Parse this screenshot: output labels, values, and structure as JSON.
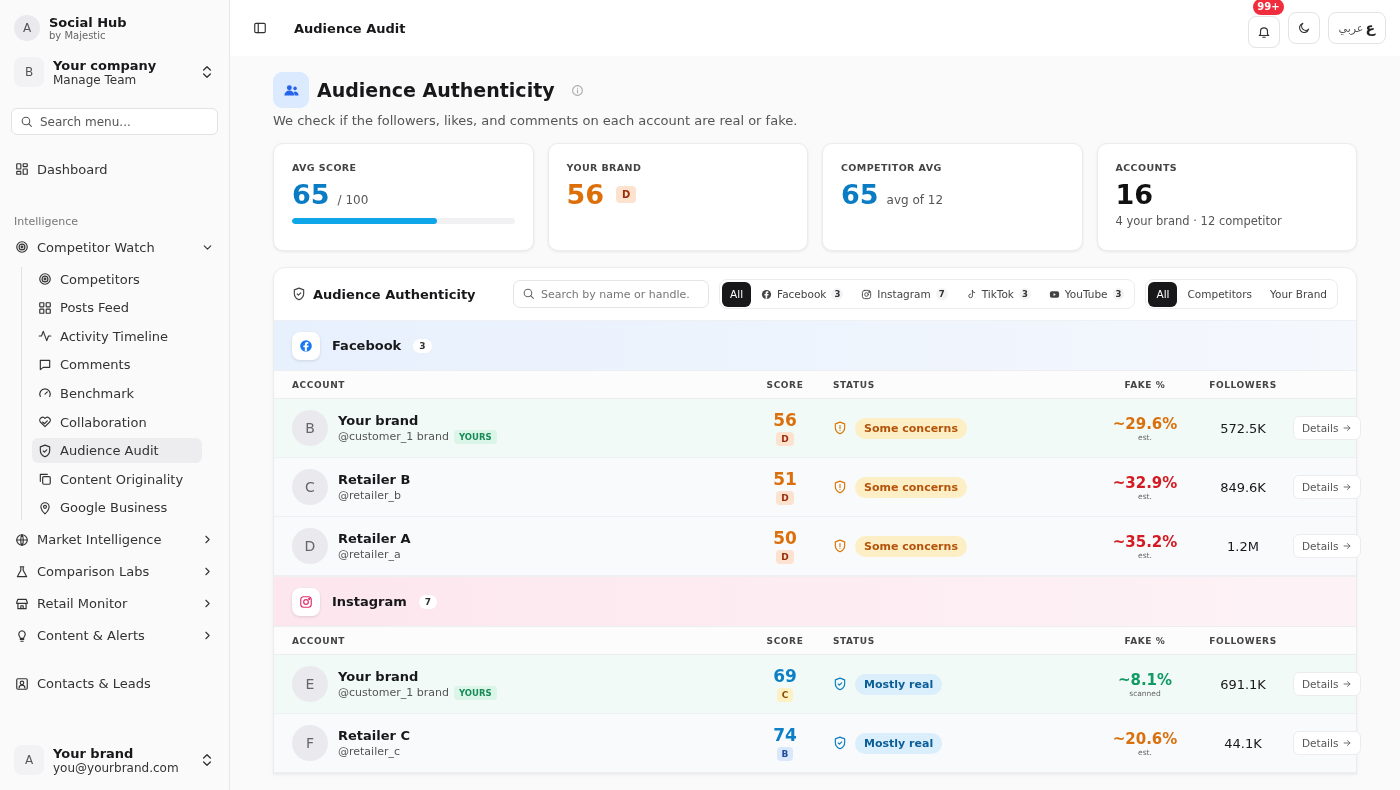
{
  "app": {
    "avatar": "A",
    "name": "Social Hub",
    "by": "by Majestic"
  },
  "team": {
    "avatar": "B",
    "name": "Your company",
    "sub": "Manage Team"
  },
  "sidebar": {
    "search": {
      "placeholder": "Search menu..."
    },
    "items": [
      {
        "kind": "link",
        "label": "Dashboard",
        "selected": false
      },
      {
        "kind": "section",
        "label": "Intelligence"
      },
      {
        "kind": "group",
        "label": "Competitor Watch",
        "expanded": true,
        "children": [
          {
            "label": "Competitors",
            "selected": false
          },
          {
            "label": "Posts Feed",
            "selected": false
          },
          {
            "label": "Activity Timeline",
            "selected": false
          },
          {
            "label": "Comments",
            "selected": false
          },
          {
            "label": "Benchmark",
            "selected": false
          },
          {
            "label": "Collaboration",
            "selected": false
          },
          {
            "label": "Audience Audit",
            "selected": true
          },
          {
            "label": "Content Originality",
            "selected": false
          },
          {
            "label": "Google Business",
            "selected": false
          }
        ]
      },
      {
        "kind": "group",
        "label": "Market Intelligence",
        "expanded": false
      },
      {
        "kind": "group",
        "label": "Comparison Labs",
        "expanded": false
      },
      {
        "kind": "group",
        "label": "Retail Monitor",
        "expanded": false
      },
      {
        "kind": "group",
        "label": "Content & Alerts",
        "expanded": false
      },
      {
        "kind": "link",
        "label": "Contacts & Leads",
        "selected": false
      }
    ]
  },
  "user": {
    "avatar": "A",
    "name": "Your brand",
    "email": "you@yourbrand.com"
  },
  "topbar": {
    "title": "Audience Audit",
    "notifications": "99+",
    "language": "عربي",
    "language_mark": "ع"
  },
  "header": {
    "title": "Audience Authenticity",
    "subtitle": "We check if the followers, likes, and comments on each account are real or fake."
  },
  "stats": [
    {
      "label": "AVG SCORE",
      "value": "65",
      "color": "#0a7cc4",
      "suffix": "/ 100",
      "level": 0.65
    },
    {
      "label": "YOUR BRAND",
      "value": "56",
      "color": "#dd6f0b",
      "grade": "D"
    },
    {
      "label": "COMPETITOR AVG",
      "value": "65",
      "color": "#0a7cc4",
      "suffix": "avg of 12"
    },
    {
      "label": "ACCOUNTS",
      "value": "16",
      "color": "#111111",
      "note": "4 your brand · 12 competitor"
    }
  ],
  "panel": {
    "title": "Audience Authenticity",
    "search": {
      "placeholder": "Search by name or handle."
    },
    "platform_filters": [
      {
        "label": "All",
        "selected": true
      },
      {
        "label": "Facebook",
        "count": "3",
        "selected": false
      },
      {
        "label": "Instagram",
        "count": "7",
        "selected": false
      },
      {
        "label": "TikTok",
        "count": "3",
        "selected": false
      },
      {
        "label": "YouTube",
        "count": "3",
        "selected": false
      }
    ],
    "owner_filters": [
      {
        "label": "All",
        "selected": true
      },
      {
        "label": "Competitors",
        "selected": false
      },
      {
        "label": "Your Brand",
        "selected": false
      }
    ],
    "groups": [
      {
        "kind": "facebook",
        "name": "Facebook",
        "count": "3",
        "columns": [
          "ACCOUNT",
          "SCORE",
          "STATUS",
          "FAKE %",
          "FOLLOWERS"
        ],
        "rows": [
          {
            "avatar": "B",
            "name": "Your brand",
            "handle": "@customer_1 brand",
            "tag": "YOURS",
            "score": "56",
            "grade": "D",
            "status": {
              "kind": "concern",
              "text": "Some concerns"
            },
            "fake": {
              "text": "~29.6%",
              "color": "#d9700c",
              "note": "est."
            },
            "followers": "572.5K",
            "action": "Details"
          },
          {
            "avatar": "C",
            "name": "Retailer B",
            "handle": "@retailer_b",
            "score": "51",
            "grade": "D",
            "status": {
              "kind": "concern",
              "text": "Some concerns"
            },
            "fake": {
              "text": "~32.9%",
              "color": "#d41b22",
              "note": "est."
            },
            "followers": "849.6K",
            "action": "Details"
          },
          {
            "avatar": "D",
            "name": "Retailer A",
            "handle": "@retailer_a",
            "score": "50",
            "grade": "D",
            "status": {
              "kind": "concern",
              "text": "Some concerns"
            },
            "fake": {
              "text": "~35.2%",
              "color": "#d41b22",
              "note": "est."
            },
            "followers": "1.2M",
            "action": "Details"
          }
        ]
      },
      {
        "kind": "instagram",
        "name": "Instagram",
        "count": "7",
        "columns": [
          "ACCOUNT",
          "SCORE",
          "STATUS",
          "FAKE %",
          "FOLLOWERS"
        ],
        "rows": [
          {
            "avatar": "E",
            "name": "Your brand",
            "handle": "@customer_1 brand",
            "tag": "YOURS",
            "score": "69",
            "grade": "C",
            "status": {
              "kind": "real",
              "text": "Mostly real"
            },
            "fake": {
              "text": "~8.1%",
              "color": "#119a64",
              "note": "scanned"
            },
            "followers": "691.1K",
            "action": "Details"
          },
          {
            "avatar": "F",
            "name": "Retailer C",
            "handle": "@retailer_c",
            "score": "74",
            "grade": "B",
            "status": {
              "kind": "real",
              "text": "Mostly real"
            },
            "fake": {
              "text": "~20.6%",
              "color": "#d9700c",
              "note": "est."
            },
            "followers": "44.1K",
            "action": "Details"
          }
        ]
      }
    ]
  }
}
